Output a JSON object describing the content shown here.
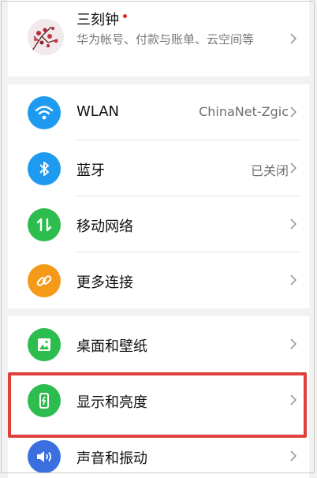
{
  "profile": {
    "name": "三刻钟",
    "description": "华为帐号、付款与账单、云空间等"
  },
  "settings": [
    {
      "label": "WLAN",
      "value": "ChinaNet-Zgic",
      "icon": "wifi-icon",
      "color": "#1e9bf0"
    },
    {
      "label": "蓝牙",
      "value": "已关闭",
      "icon": "bluetooth-icon",
      "color": "#1e9bf0"
    },
    {
      "label": "移动网络",
      "value": "",
      "icon": "mobile-network-icon",
      "color": "#2dbd4e"
    },
    {
      "label": "更多连接",
      "value": "",
      "icon": "link-icon",
      "color": "#f59a18"
    },
    {
      "label": "桌面和壁纸",
      "value": "",
      "icon": "wallpaper-icon",
      "color": "#2dbd4e"
    },
    {
      "label": "显示和亮度",
      "value": "",
      "icon": "display-icon",
      "color": "#2dbd4e"
    },
    {
      "label": "声音和振动",
      "value": "",
      "icon": "sound-icon",
      "color": "#3b6fe0"
    }
  ],
  "highlight_color": "#e0403a"
}
